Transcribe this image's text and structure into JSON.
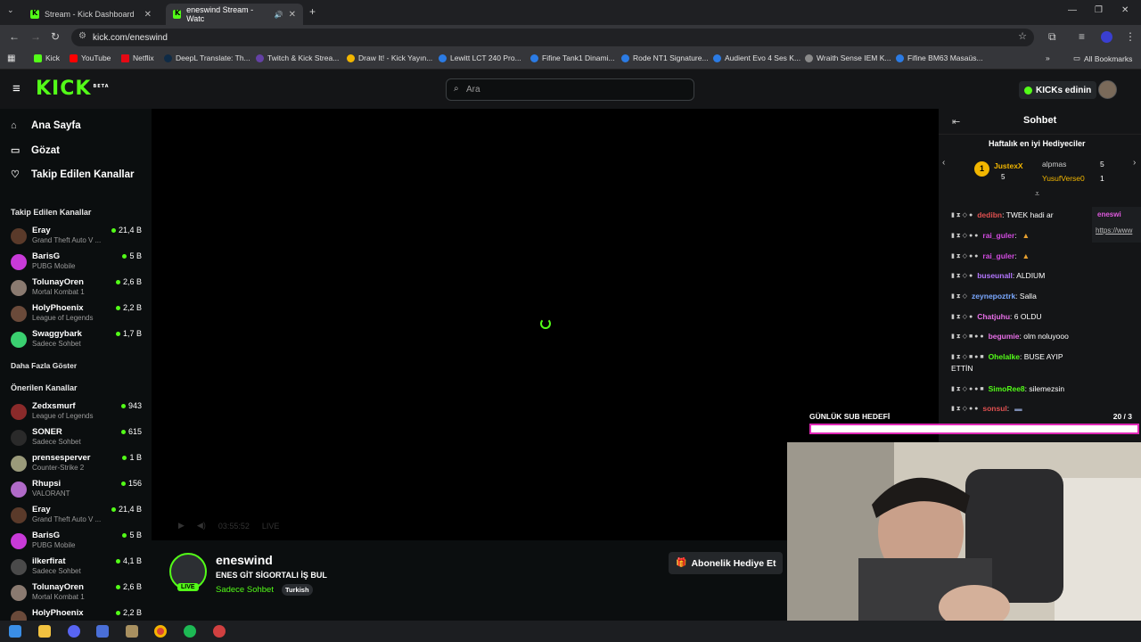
{
  "browser": {
    "tabs": [
      {
        "title": "Stream - Kick Dashboard"
      },
      {
        "title": "eneswind Stream - Watc"
      }
    ],
    "url": "kick.com/eneswind",
    "bookmarks": [
      "Kick",
      "YouTube",
      "Netflix",
      "DeepL Translate: Th...",
      "Twitch & Kick Strea...",
      "Draw It! - Kick Yayın...",
      "Lewitt LCT 240 Pro...",
      "Fifine Tank1 Dinami...",
      "Rode NT1 Signature...",
      "Audient Evo 4 Ses K...",
      "Wraith Sense IEM K...",
      "Fifine BM63 Masaüs..."
    ],
    "all_bookmarks": "All Bookmarks"
  },
  "header": {
    "logo": "KICK",
    "logo_badge": "BETA",
    "search_placeholder": "Ara",
    "kicks_button": "KICKs edinin"
  },
  "sidebar": {
    "nav": [
      {
        "label": "Ana Sayfa",
        "icon": "home-icon"
      },
      {
        "label": "Gözat",
        "icon": "compass-icon"
      },
      {
        "label": "Takip Edilen Kanallar",
        "icon": "heart-icon"
      }
    ],
    "followed_header": "Takip Edilen Kanallar",
    "followed": [
      {
        "name": "Eray",
        "game": "Grand Theft Auto V ...",
        "viewers": "21,4 B"
      },
      {
        "name": "BarisG",
        "game": "PUBG Mobile",
        "viewers": "5 B"
      },
      {
        "name": "TolunayOren",
        "game": "Mortal Kombat 1",
        "viewers": "2,6 B"
      },
      {
        "name": "HolyPhoenix",
        "game": "League of Legends",
        "viewers": "2,2 B"
      },
      {
        "name": "Swaggybark",
        "game": "Sadece Sohbet",
        "viewers": "1,7 B"
      }
    ],
    "show_more": "Daha Fazla Göster",
    "recommended_header": "Önerilen Kanallar",
    "recommended": [
      {
        "name": "Zedxsmurf",
        "game": "League of Legends",
        "viewers": "943"
      },
      {
        "name": "SONER",
        "game": "Sadece Sohbet",
        "viewers": "615"
      },
      {
        "name": "prensesperver",
        "game": "Counter-Strike 2",
        "viewers": "1 B"
      },
      {
        "name": "Rhupsi",
        "game": "VALORANT",
        "viewers": "156"
      },
      {
        "name": "Eray",
        "game": "Grand Theft Auto V ...",
        "viewers": "21,4 B"
      },
      {
        "name": "BarisG",
        "game": "PUBG Mobile",
        "viewers": "5 B"
      },
      {
        "name": "ilkerfirat",
        "game": "Sadece Sohbet",
        "viewers": "4,1 B"
      },
      {
        "name": "TolunayOren",
        "game": "Mortal Kombat 1",
        "viewers": "2,6 B"
      },
      {
        "name": "HolyPhoenix",
        "game": "",
        "viewers": "2,2 B"
      }
    ]
  },
  "player": {
    "time": "03:55:52",
    "live": "LIVE"
  },
  "stream": {
    "channel": "eneswind",
    "title": "ENES GİT SİGORTALI İŞ BUL",
    "category": "Sadece Sohbet",
    "tag": "Turkish",
    "live_badge": "LIVE",
    "gift_button": "Abonelik Hediye Et"
  },
  "chat": {
    "title": "Sohbet",
    "gifters_title": "Haftalık en iyi Hediyeciler",
    "gifters": [
      {
        "rank": "1",
        "name": "JustexX",
        "count": "5"
      },
      {
        "name": "alpmas",
        "count": "5"
      },
      {
        "name": "YusufVerse0",
        "count": "1"
      }
    ],
    "messages": [
      {
        "user": "dedibn",
        "text": ": TWEK hadi ar",
        "color": "#e05050"
      },
      {
        "user": "rai_guler",
        "text": ":",
        "color": "#d24be0"
      },
      {
        "user": "rai_guler",
        "text": ":",
        "color": "#d24be0"
      },
      {
        "user": "buseunall",
        "text": ": ALDIUM",
        "color": "#b476ff"
      },
      {
        "user": "zeynepoztrk",
        "text": ": Salla",
        "color": "#7aa8ff"
      },
      {
        "user": "Chatjuhu",
        "text": ": 6 OLDU",
        "color": "#e66ee6"
      },
      {
        "user": "begumie",
        "text": ": olm noluyooo",
        "color": "#e66ee6"
      },
      {
        "user": "Ohelalke",
        "text": ": BUSE AYIP",
        "color": "#53fc18"
      },
      {
        "user": "",
        "text": "ETTİN",
        "color": "#ffffff"
      },
      {
        "user": "SimoRee8",
        "text": ": silemezsin",
        "color": "#53fc18"
      },
      {
        "user": "sonsul",
        "text": ":",
        "color": "#e05050"
      }
    ],
    "pinned_user": "eneswi",
    "pinned_link": "https://www"
  },
  "overlay": {
    "goal_label": "GÜNLÜK SUB HEDEFİ",
    "goal_count": "20 / 3",
    "goal_progress": 0.98
  }
}
